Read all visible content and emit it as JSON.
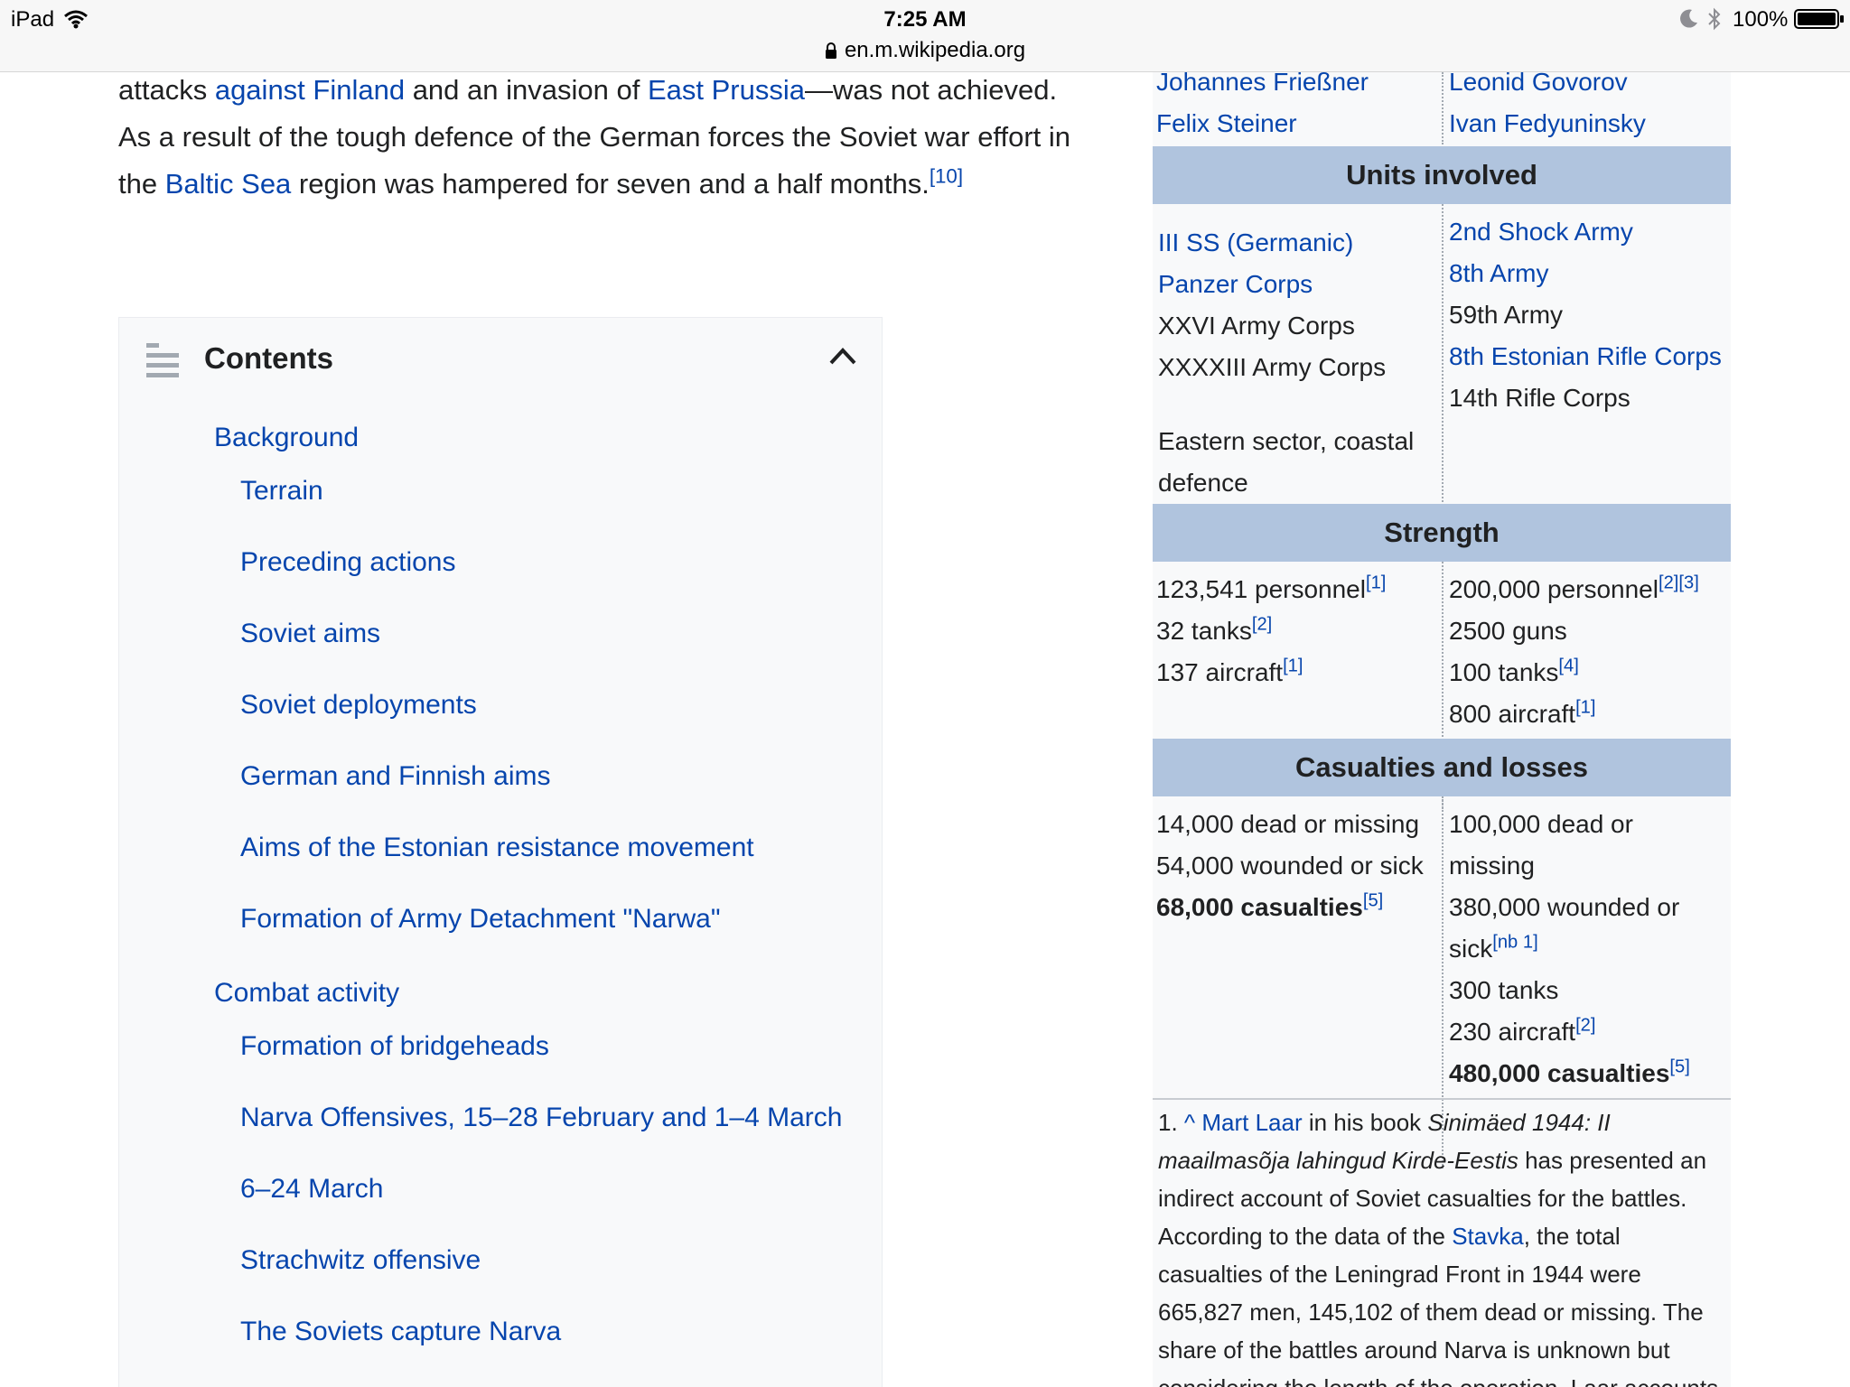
{
  "status_bar": {
    "device": "iPad",
    "time": "7:25 AM",
    "url": "en.m.wikipedia.org",
    "battery": "100%"
  },
  "intro": {
    "t1": "attacks ",
    "l1": "against Finland",
    "t2": " and an invasion of ",
    "l2": "East Prussia",
    "t3": "—was not achieved. As a result of the tough defence of the German forces the Soviet war effort in the ",
    "l3": "Baltic Sea",
    "t4": " region was hampered for seven and a half months.",
    "ref": "[10]"
  },
  "toc": {
    "title": "Contents",
    "items": [
      "Background",
      "Terrain",
      "Preceding actions",
      "Soviet aims",
      "Soviet deployments",
      "German and Finnish aims",
      "Aims of the Estonian resistance movement",
      "Formation of Army Detachment \"Narwa\"",
      "Combat activity",
      "Formation of bridgeheads",
      "Narva Offensives, 15–28 February and 1–4 March",
      "6–24 March",
      "Strachwitz offensive",
      "The Soviets capture Narva"
    ]
  },
  "infobox": {
    "commanders": {
      "left": [
        "Johannes Frießner",
        "Felix Steiner"
      ],
      "right": [
        "Leonid Govorov",
        "Ivan Fedyuninsky"
      ]
    },
    "units_header": "Units involved",
    "units": {
      "left_link": "III SS (Germanic) Panzer Corps",
      "left": [
        "XXVI Army Corps",
        "XXXXIII Army Corps"
      ],
      "left_extra": "Eastern sector, coastal defence",
      "right": [
        "2nd Shock Army",
        "8th Army",
        "59th Army",
        "8th Estonian Rifle Corps",
        "14th Rifle Corps"
      ]
    },
    "strength_header": "Strength",
    "strength": {
      "left": [
        {
          "text": "123,541 personnel",
          "ref": "[1]"
        },
        {
          "text": "32 tanks",
          "ref": "[2]"
        },
        {
          "text": "137 aircraft",
          "ref": "[1]"
        }
      ],
      "right": [
        {
          "text": "200,000 personnel",
          "ref": "[2][3]"
        },
        {
          "text": "2500 guns",
          "ref": ""
        },
        {
          "text": "100 tanks",
          "ref": "[4]"
        },
        {
          "text": "800 aircraft",
          "ref": "[1]"
        }
      ]
    },
    "casualties_header": "Casualties and losses",
    "casualties": {
      "left": [
        "14,000 dead or missing",
        "54,000 wounded or sick"
      ],
      "left_total": "68,000 casualties",
      "left_total_ref": "[5]",
      "right_a": "100,000 dead or missing",
      "right_b": "380,000 wounded or sick",
      "right_b_ref": "[nb 1]",
      "right_c": "300 tanks",
      "right_d": "230 aircraft",
      "right_d_ref": "[2]",
      "right_total": "480,000 casualties",
      "right_total_ref": "[5]"
    },
    "note": {
      "num": "1. ",
      "caret": "^",
      "author": "Mart Laar",
      "t1": " in his book ",
      "book": "Sinimäed 1944: II maailmasõja lahingud Kirde-Eestis",
      "t2": " has presented an indirect account of Soviet casualties for the battles. According to the data of the ",
      "stavka": "Stavka",
      "t3": ", the total casualties of the Leningrad Front in 1944 were 665,827 men, 145,102 of them dead or missing. The share of the battles around Narva is unknown but considering the length of the operation, Laar accounts"
    }
  }
}
